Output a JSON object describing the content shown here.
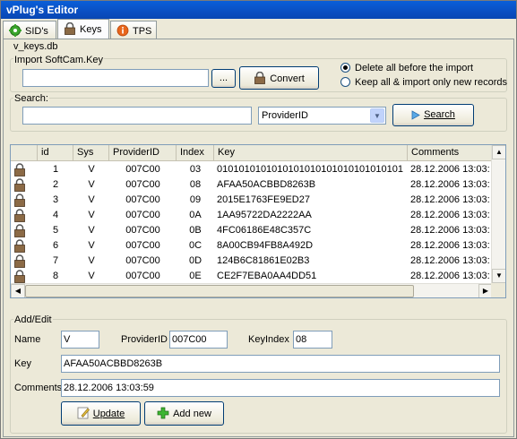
{
  "window": {
    "title": "vPlug's Editor"
  },
  "tabs": [
    {
      "label": "SID's",
      "icon": "gear-icon"
    },
    {
      "label": "Keys",
      "icon": "lock-icon"
    },
    {
      "label": "TPS",
      "icon": "info-icon"
    }
  ],
  "db_label": "v_keys.db",
  "import": {
    "group_label": "Import SoftCam.Key",
    "path_value": "",
    "browse_label": "...",
    "convert_label": "Convert",
    "options": [
      {
        "label": "Delete all before the import",
        "selected": true
      },
      {
        "label": "Keep all & import only new records",
        "selected": false
      }
    ]
  },
  "search": {
    "group_label": "Search:",
    "query_value": "",
    "field_value": "ProviderID",
    "button_label": "Search"
  },
  "grid": {
    "columns": [
      "id",
      "Sys",
      "ProviderID",
      "Index",
      "Key",
      "Comments"
    ],
    "rows": [
      {
        "id": "1",
        "sys": "V",
        "provider": "007C00",
        "index": "03",
        "key": "0101010101010101010101010101010101",
        "comments": "28.12.2006 13:03:"
      },
      {
        "id": "2",
        "sys": "V",
        "provider": "007C00",
        "index": "08",
        "key": "AFAA50ACBBD8263B",
        "comments": "28.12.2006 13:03:"
      },
      {
        "id": "3",
        "sys": "V",
        "provider": "007C00",
        "index": "09",
        "key": "2015E1763FE9ED27",
        "comments": "28.12.2006 13:03:"
      },
      {
        "id": "4",
        "sys": "V",
        "provider": "007C00",
        "index": "0A",
        "key": "1AA95722DA2222AA",
        "comments": "28.12.2006 13:03:"
      },
      {
        "id": "5",
        "sys": "V",
        "provider": "007C00",
        "index": "0B",
        "key": "4FC06186E48C357C",
        "comments": "28.12.2006 13:03:"
      },
      {
        "id": "6",
        "sys": "V",
        "provider": "007C00",
        "index": "0C",
        "key": "8A00CB94FB8A492D",
        "comments": "28.12.2006 13:03:"
      },
      {
        "id": "7",
        "sys": "V",
        "provider": "007C00",
        "index": "0D",
        "key": "124B6C81861E02B3",
        "comments": "28.12.2006 13:03:"
      },
      {
        "id": "8",
        "sys": "V",
        "provider": "007C00",
        "index": "0E",
        "key": "CE2F7EBA0AA4DD51",
        "comments": "28.12.2006 13:03:"
      }
    ]
  },
  "edit": {
    "group_label": "Add/Edit",
    "name_label": "Name",
    "name_value": "V",
    "provider_label": "ProviderID",
    "provider_value": "007C00",
    "keyindex_label": "KeyIndex",
    "keyindex_value": "08",
    "key_label": "Key",
    "key_value": "AFAA50ACBBD8263B",
    "comments_label": "Comments",
    "comments_value": "28.12.2006 13:03:59",
    "update_label": "Update",
    "addnew_label": "Add new"
  }
}
